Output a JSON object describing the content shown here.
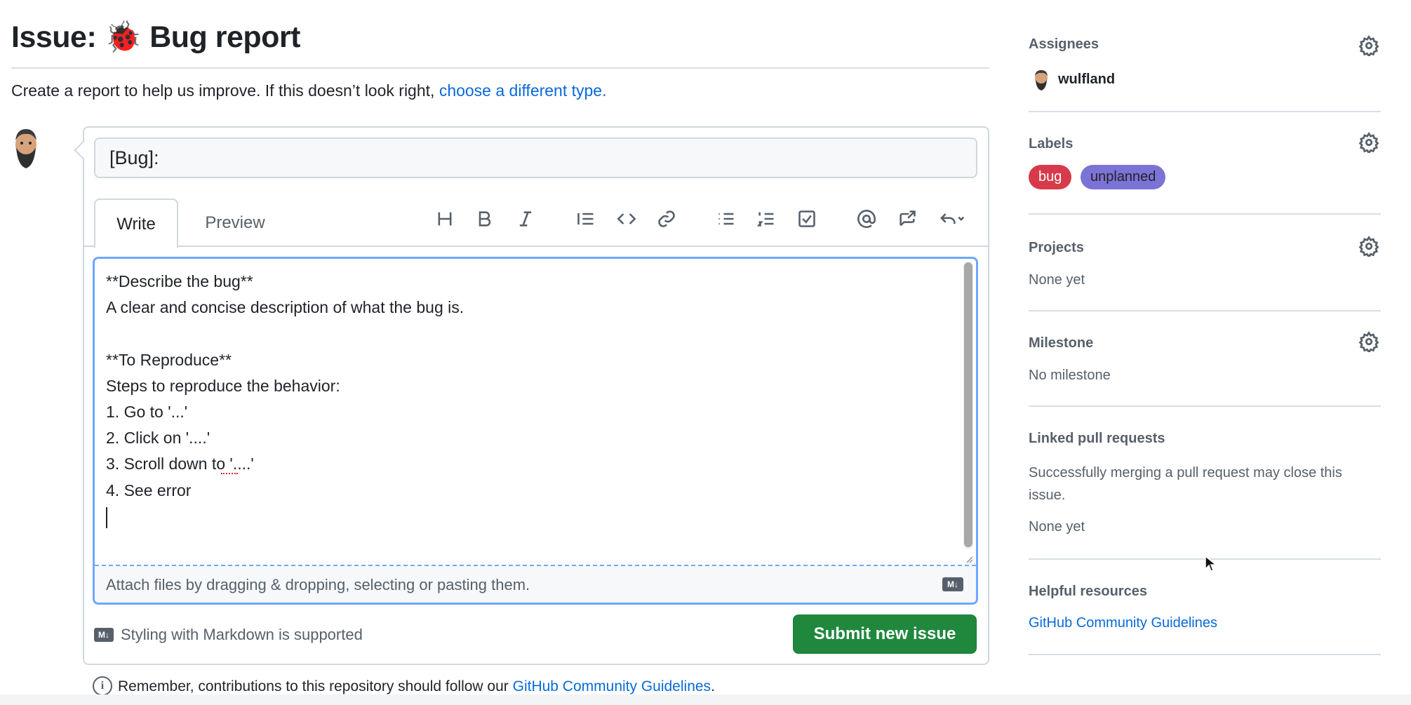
{
  "header": {
    "title_prefix": "Issue:",
    "title_emoji": "🐞",
    "title_text": "Bug report",
    "intro_text": "Create a report to help us improve. If this doesn’t look right, ",
    "intro_link": "choose a different type."
  },
  "form": {
    "title_value": "[Bug]:",
    "tabs": [
      {
        "label": "Write",
        "active": true
      },
      {
        "label": "Preview",
        "active": false
      }
    ],
    "toolbar": [
      "heading-icon",
      "bold-icon",
      "italic-icon",
      "quote-icon",
      "code-icon",
      "link-icon",
      "bulleted-list-icon",
      "numbered-list-icon",
      "task-list-icon",
      "mention-icon",
      "cross-reference-icon",
      "reply-icon"
    ],
    "body_value": "**Describe the bug**\nA clear and concise description of what the bug is.\n\n**To Reproduce**\nSteps to reproduce the behavior:\n1. Go to '...'\n2. Click on '....'\n3. Scroll down to '....'\n4. See error\n",
    "attach_text": "Attach files by dragging & dropping, selecting or pasting them.",
    "markdown_badge": "M↓",
    "markdown_note": "Styling with Markdown is supported",
    "submit_label": "Submit new issue",
    "remember_text": "Remember, contributions to this repository should follow our ",
    "remember_link": "GitHub Community Guidelines",
    "remember_end": "."
  },
  "sidebar": {
    "assignees": {
      "heading": "Assignees",
      "user": "wulfland"
    },
    "labels": {
      "heading": "Labels",
      "items": [
        {
          "name": "bug",
          "color": "#d73a4a"
        },
        {
          "name": "unplanned",
          "color": "#7c73d6"
        }
      ]
    },
    "projects": {
      "heading": "Projects",
      "value": "None yet"
    },
    "milestone": {
      "heading": "Milestone",
      "value": "No milestone"
    },
    "linked_prs": {
      "heading": "Linked pull requests",
      "description": "Successfully merging a pull request may close this issue.",
      "value": "None yet"
    },
    "resources": {
      "heading": "Helpful resources",
      "link": "GitHub Community Guidelines"
    }
  },
  "colors": {
    "primary_button": "#1f883d",
    "link": "#0969da",
    "focus_border": "#6ea8ff"
  }
}
